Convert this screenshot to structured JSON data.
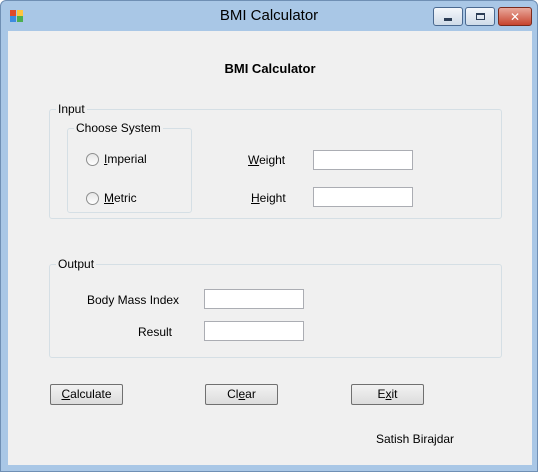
{
  "window": {
    "title": "BMI Calculator",
    "colors": {
      "titlebar": "#a9c7e6",
      "client": "#f0f0f0",
      "close": "#c7442e"
    }
  },
  "form": {
    "heading": "BMI Calculator",
    "input_group": {
      "label": "Input",
      "system_group": {
        "label": "Choose System",
        "options": [
          {
            "label_pre": "",
            "label_u": "I",
            "label_post": "mperial",
            "selected": false
          },
          {
            "label_pre": "",
            "label_u": "M",
            "label_post": "etric",
            "selected": false
          }
        ]
      },
      "weight": {
        "label_u": "W",
        "label_post": "eight",
        "value": ""
      },
      "height": {
        "label_u": "H",
        "label_post": "eight",
        "value": ""
      }
    },
    "output_group": {
      "label": "Output",
      "bmi": {
        "label": "Body Mass Index",
        "value": ""
      },
      "result": {
        "label": "Result",
        "value": ""
      }
    },
    "buttons": {
      "calculate": {
        "label_u": "C",
        "label_post": "alculate"
      },
      "clear": {
        "label_pre": "Cl",
        "label_u": "e",
        "label_post": "ar"
      },
      "exit": {
        "label_pre": "E",
        "label_u": "x",
        "label_post": "it"
      }
    },
    "author": "Satish Birajdar"
  }
}
